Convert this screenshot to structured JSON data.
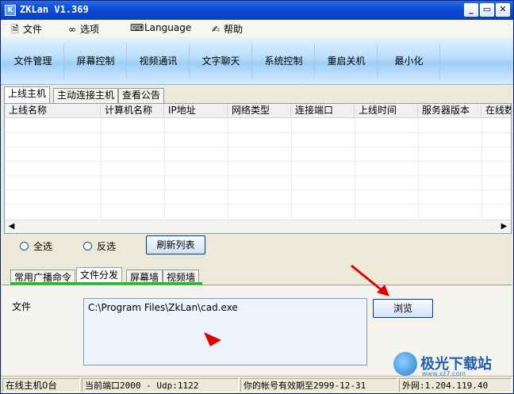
{
  "window": {
    "title": "ZKLan V1.369",
    "minimize": "_",
    "restore": "▭",
    "close": "✕"
  },
  "menu": [
    {
      "label": "文件",
      "icon": "file-icon"
    },
    {
      "label": "选项",
      "icon": "glasses-icon"
    },
    {
      "label": "Language",
      "icon": "language-icon"
    },
    {
      "label": "帮助",
      "icon": "help-icon"
    }
  ],
  "toolbar": [
    "文件管理",
    "屏幕控制",
    "视频通讯",
    "文字聊天",
    "系统控制",
    "重启关机",
    "最小化"
  ],
  "tabs": [
    "上线主机",
    "主动连接主机",
    "查看公告"
  ],
  "list": {
    "columns": [
      "上线名称",
      "计算机名称",
      "IP地址",
      "网络类型",
      "连接端口",
      "上线时间",
      "服务器版本",
      "在线数"
    ],
    "rows": []
  },
  "selection": {
    "select_all": "全选",
    "invert": "反选",
    "refresh": "刷新列表"
  },
  "subtabs": [
    "常用广播命令",
    "文件分发",
    "屏幕墙",
    "视频墙"
  ],
  "distribution": {
    "file_label": "文件",
    "file_value": "C:\\Program Files\\ZkLan\\cad.exe",
    "browse": "浏览"
  },
  "status": {
    "online": "在线主机0台",
    "port": "当前端口2000 - Udp:1122",
    "expiry": "你的帐号有效期至2999-12-31",
    "wan": "外网:1.204.119.40"
  },
  "watermark": {
    "text": "极光下载站",
    "sub": "www.xz7.com"
  },
  "colors": {
    "title_bar": "#0b4ed6",
    "accent_tab": "#18c018",
    "arrow": "#e00000"
  }
}
